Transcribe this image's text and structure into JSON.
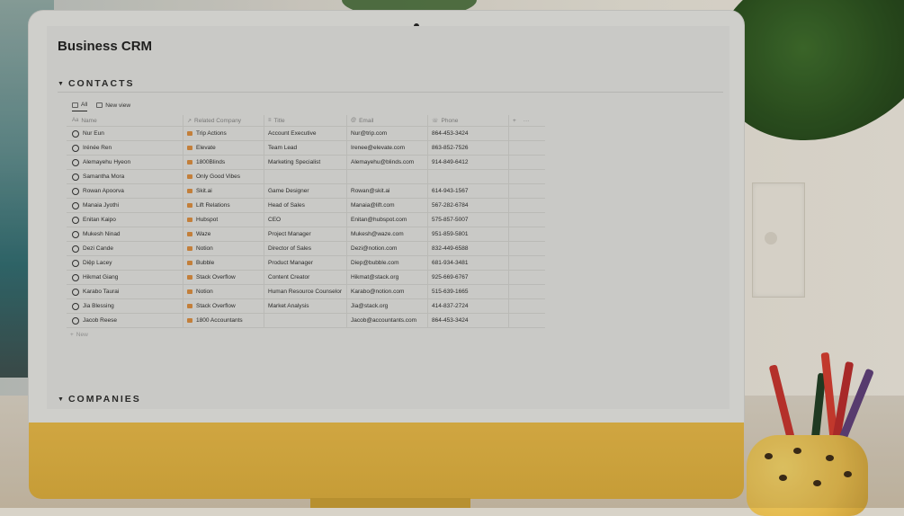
{
  "page": {
    "title": "Business CRM"
  },
  "contacts_section": {
    "label": "CONTACTS",
    "views": [
      {
        "label": "All",
        "icon": "table-icon"
      },
      {
        "label": "New view",
        "icon": "table-icon"
      }
    ],
    "columns": [
      {
        "label": "Name",
        "icon": "text-icon"
      },
      {
        "label": "Related Company",
        "icon": "relation-icon"
      },
      {
        "label": "Title",
        "icon": "text-icon"
      },
      {
        "label": "Email",
        "icon": "at-icon"
      },
      {
        "label": "Phone",
        "icon": "phone-icon"
      }
    ],
    "add_column": "+",
    "more_options": "···",
    "new_row_label": "New",
    "rows": [
      {
        "name": "Nur Eun",
        "company": "Trip Actions",
        "title": "Account Executive",
        "email": "Nur@trip.com",
        "phone": "864-453-3424"
      },
      {
        "name": "Irénée Ren",
        "company": "Elevate",
        "title": "Team Lead",
        "email": "Irenee@elevate.com",
        "phone": "863-852-7526"
      },
      {
        "name": "Alemayehu Hyeon",
        "company": "1800Blinds",
        "title": "Marketing Specialist",
        "email": "Alemayehu@blinds.com",
        "phone": "914-849-6412"
      },
      {
        "name": "Samantha Mora",
        "company": "Only Good Vibes",
        "title": "",
        "email": "",
        "phone": ""
      },
      {
        "name": "Rowan Apoorva",
        "company": "Skit.ai",
        "title": "Game Designer",
        "email": "Rowan@skit.ai",
        "phone": "614-943-1567"
      },
      {
        "name": "Manaia Jyothi",
        "company": "Lift Relations",
        "title": "Head of Sales",
        "email": "Manaia@lift.com",
        "phone": "567-282-6784"
      },
      {
        "name": "Enitan Kaipo",
        "company": "Hubspot",
        "title": "CEO",
        "email": "Enitan@hubspot.com",
        "phone": "575-857-5007"
      },
      {
        "name": "Mukesh Ninad",
        "company": "Waze",
        "title": "Project Manager",
        "email": "Mukesh@waze.com",
        "phone": "951-859-5801"
      },
      {
        "name": "Dezi Cande",
        "company": "Notion",
        "title": "Director of Sales",
        "email": "Dezi@notion.com",
        "phone": "832-449-6588"
      },
      {
        "name": "Diệp Lacey",
        "company": "Bubble",
        "title": "Product Manager",
        "email": "Diep@bubble.com",
        "phone": "681-934-3481"
      },
      {
        "name": "Hikmat Giang",
        "company": "Stack Overflow",
        "title": "Content Creator",
        "email": "Hikmat@stack.org",
        "phone": "925-669-6767"
      },
      {
        "name": "Karabo Taurai",
        "company": "Notion",
        "title": "Human Resource Counselor",
        "email": "Karabo@notion.com",
        "phone": "515-639-1665"
      },
      {
        "name": "Jia Blessing",
        "company": "Stack Overflow",
        "title": "Market Analysis",
        "email": "Jia@stack.org",
        "phone": "414-837-2724"
      },
      {
        "name": "Jacob Reese",
        "company": "1800 Accountants",
        "title": "",
        "email": "Jacob@accountants.com",
        "phone": "864-453-3424"
      }
    ]
  },
  "companies_section": {
    "label": "COMPANIES"
  },
  "colors": {
    "company_icon": "#d58a3e",
    "chin": "#e3b545"
  }
}
